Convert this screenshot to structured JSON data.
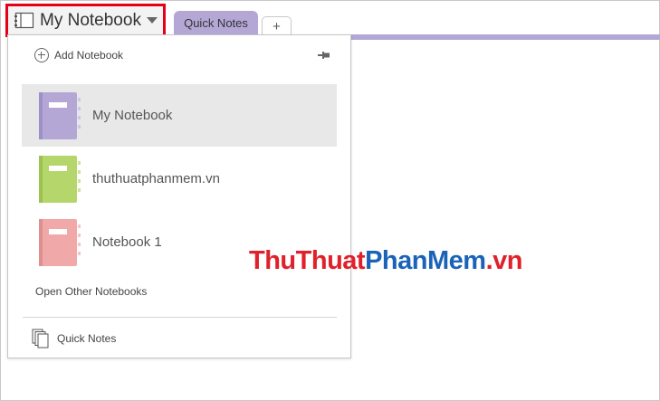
{
  "header": {
    "notebook_title": "My Notebook",
    "notebook_icon": "notebook-icon",
    "caret_icon": "caret-down-icon"
  },
  "tabs": [
    {
      "label": "Quick Notes",
      "color": "#b4a7d6",
      "active": true
    },
    {
      "label": "+",
      "kind": "add-section"
    }
  ],
  "dropdown": {
    "add_label": "Add Notebook",
    "pin_icon": "pin-icon",
    "notebooks": [
      {
        "name": "My Notebook",
        "color": "#b4a7d6",
        "selected": true
      },
      {
        "name": "thuthuatphanmem.vn",
        "color": "#b5d66b",
        "selected": false
      },
      {
        "name": "Notebook 1",
        "color": "#f0a8a8",
        "selected": false
      }
    ],
    "open_other_label": "Open Other Notebooks",
    "quick_notes_label": "Quick Notes"
  },
  "watermark": {
    "part1": "ThuThuat",
    "part2": "PhanMem",
    "part3": ".vn"
  },
  "colors": {
    "accent": "#b4a7d6",
    "highlight_border": "#e5001a"
  }
}
